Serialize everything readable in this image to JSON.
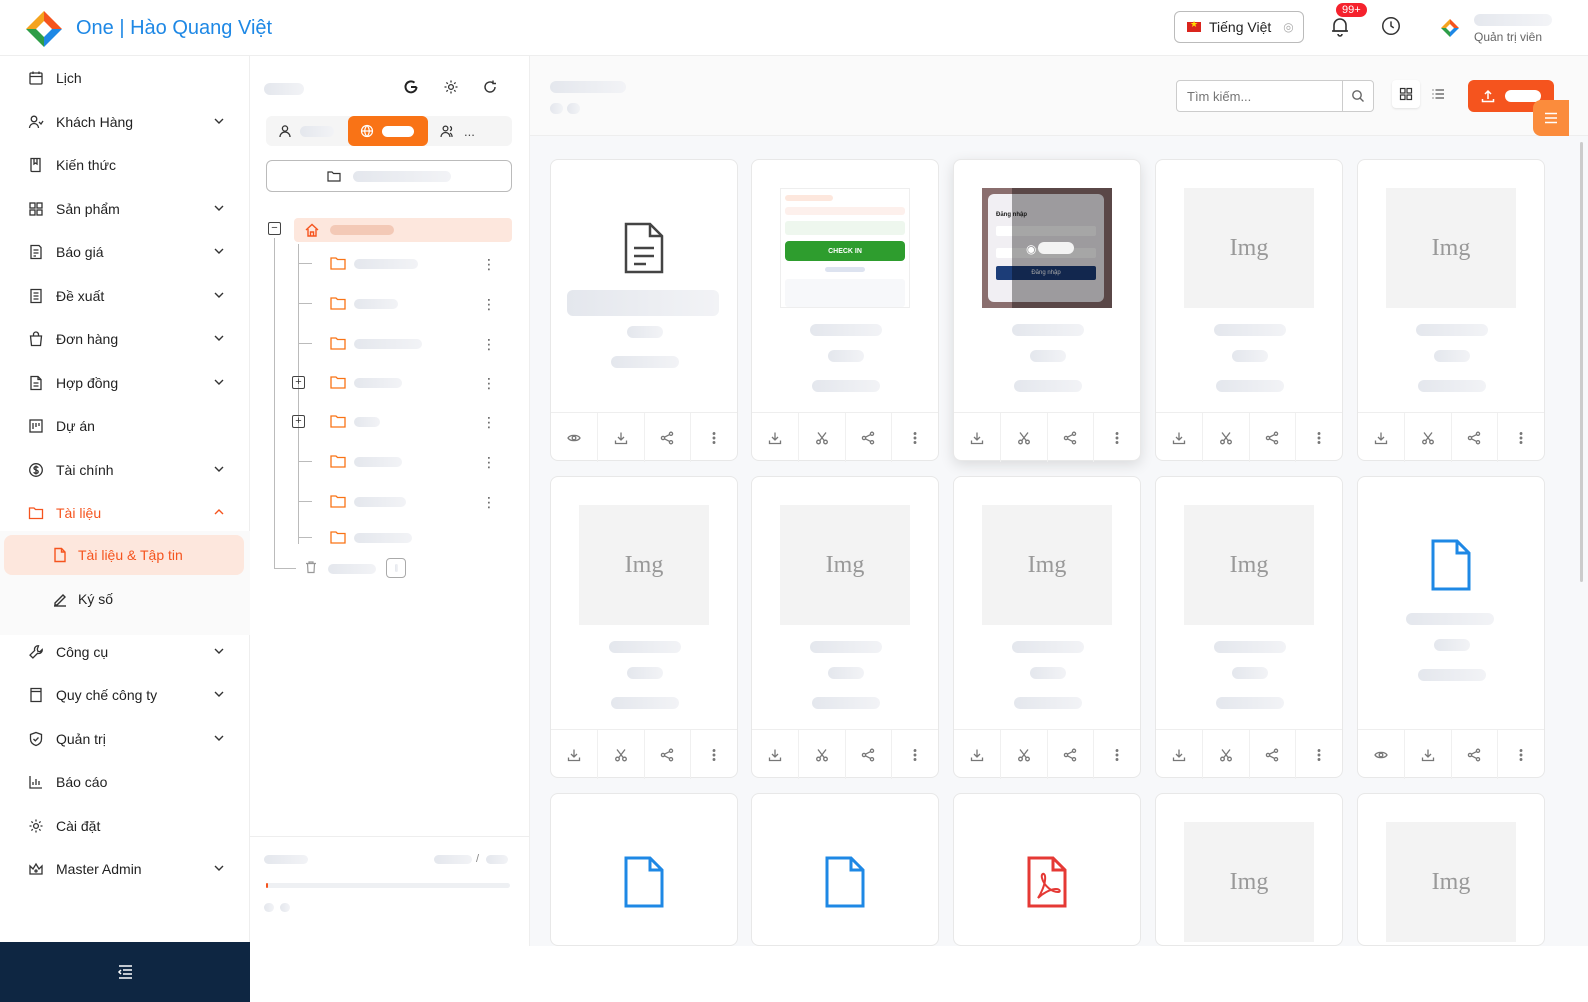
{
  "header": {
    "brand": "One | Hào Quang Việt",
    "language": "Tiếng Việt",
    "notification_count": "99+",
    "user_role": "Quản trị viên"
  },
  "sidebar": {
    "items": [
      {
        "label": "Lịch",
        "icon": "calendar-icon",
        "has_children": false
      },
      {
        "label": "Khách Hàng",
        "icon": "customer-icon",
        "has_children": true
      },
      {
        "label": "Kiến thức",
        "icon": "book-icon",
        "has_children": false
      },
      {
        "label": "Sản phẩm",
        "icon": "grid-icon",
        "has_children": true
      },
      {
        "label": "Báo giá",
        "icon": "quote-icon",
        "has_children": true
      },
      {
        "label": "Đề xuất",
        "icon": "proposal-icon",
        "has_children": true
      },
      {
        "label": "Đơn hàng",
        "icon": "bag-icon",
        "has_children": true
      },
      {
        "label": "Hợp đồng",
        "icon": "contract-icon",
        "has_children": true
      },
      {
        "label": "Dự án",
        "icon": "project-icon",
        "has_children": false
      },
      {
        "label": "Tài chính",
        "icon": "dollar-icon",
        "has_children": true
      },
      {
        "label": "Tài liệu",
        "icon": "folder-icon",
        "has_children": true,
        "active": true
      },
      {
        "label": "Công cụ",
        "icon": "wrench-icon",
        "has_children": true
      },
      {
        "label": "Quy chế công ty",
        "icon": "rules-icon",
        "has_children": true
      },
      {
        "label": "Quản trị",
        "icon": "shield-icon",
        "has_children": true
      },
      {
        "label": "Báo cáo",
        "icon": "chart-icon",
        "has_children": false
      },
      {
        "label": "Cài đặt",
        "icon": "gear-icon",
        "has_children": false
      },
      {
        "label": "Master Admin",
        "icon": "crown-icon",
        "has_children": true
      }
    ],
    "submenu": [
      {
        "label": "Tài liệu & Tập tin",
        "icon": "file-icon",
        "active": true
      },
      {
        "label": "Ký số",
        "icon": "sign-icon",
        "active": false
      }
    ]
  },
  "tree_panel": {
    "tool_buttons": [
      "google-icon",
      "gear-icon",
      "refresh-icon"
    ],
    "seg_third_label": "..."
  },
  "main": {
    "search_placeholder": "Tìm kiếm...",
    "cards": [
      {
        "type": "doc-gray",
        "actions": [
          "eye",
          "download",
          "share",
          "more"
        ]
      },
      {
        "type": "screenshot-checkin",
        "actions": [
          "download",
          "cut",
          "share",
          "more"
        ]
      },
      {
        "type": "screenshot-login",
        "actions": [
          "download",
          "cut",
          "share",
          "more"
        ],
        "hover": true
      },
      {
        "type": "img",
        "actions": [
          "download",
          "cut",
          "share",
          "more"
        ]
      },
      {
        "type": "img",
        "actions": [
          "download",
          "cut",
          "share",
          "more"
        ]
      },
      {
        "type": "img",
        "actions": [
          "download",
          "cut",
          "share",
          "more"
        ]
      },
      {
        "type": "img",
        "actions": [
          "download",
          "cut",
          "share",
          "more"
        ]
      },
      {
        "type": "img",
        "actions": [
          "download",
          "cut",
          "share",
          "more"
        ]
      },
      {
        "type": "img",
        "actions": [
          "download",
          "cut",
          "share",
          "more"
        ]
      },
      {
        "type": "doc-blue",
        "actions": [
          "eye",
          "download",
          "share",
          "more"
        ]
      },
      {
        "type": "doc-blue",
        "actions": []
      },
      {
        "type": "doc-blue",
        "actions": []
      },
      {
        "type": "pdf",
        "actions": []
      },
      {
        "type": "img",
        "actions": []
      },
      {
        "type": "img",
        "actions": []
      }
    ],
    "img_placeholder": "Img",
    "checkin_label": "CHECK IN",
    "login_title": "Đăng nhập",
    "login_button": "Đăng nhập"
  },
  "colors": {
    "accent": "#f5541e",
    "brand_blue": "#1e88e5",
    "sidebar_footer": "#0e2642"
  }
}
